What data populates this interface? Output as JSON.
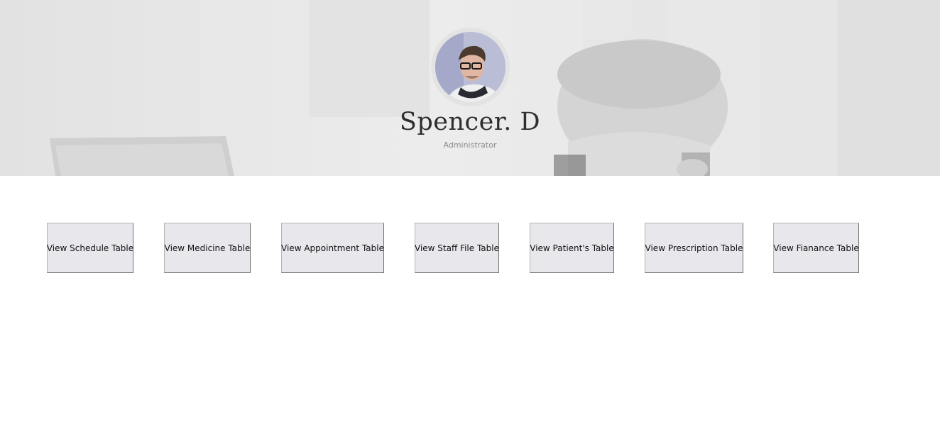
{
  "profile": {
    "name": "Spencer. D",
    "role": "Administrator"
  },
  "buttons": [
    {
      "label": "View Schedule Table"
    },
    {
      "label": "View Medicine Table"
    },
    {
      "label": "View Appointment Table"
    },
    {
      "label": "View Staff File Table"
    },
    {
      "label": "View Patient's Table"
    },
    {
      "label": "View Prescription Table"
    },
    {
      "label": "View Fianance Table"
    }
  ],
  "colors": {
    "banner": "#e9e9e9",
    "button_face": "#e8e7eb",
    "name_text": "#2e2e2e",
    "role_text": "#8a8a8a"
  }
}
